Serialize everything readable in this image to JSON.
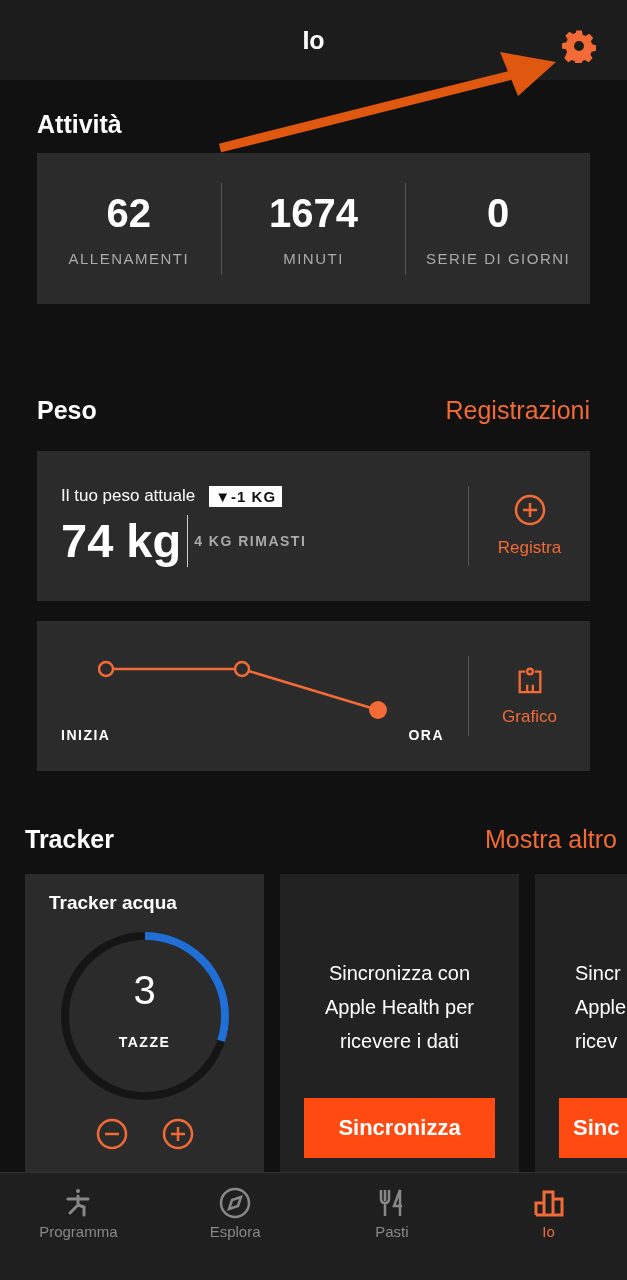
{
  "header": {
    "title": "Io"
  },
  "activity": {
    "title": "Attività",
    "stats": [
      {
        "value": "62",
        "label": "ALLENAMENTI"
      },
      {
        "value": "1674",
        "label": "MINUTI"
      },
      {
        "value": "0",
        "label": "SERIE DI GIORNI"
      }
    ]
  },
  "weight": {
    "title": "Peso",
    "link": "Registrazioni",
    "current_label": "Il tuo peso attuale",
    "change_badge": "▼-1 KG",
    "value": "74 kg",
    "remaining": "4 KG RIMASTI",
    "log_button": "Registra",
    "chart_start": "INIZIA",
    "chart_end": "ORA",
    "chart_button": "Grafico"
  },
  "tracker": {
    "title": "Tracker",
    "link": "Mostra altro",
    "water": {
      "title": "Tracker acqua",
      "count": "3",
      "unit": "TAZZE",
      "level": 0.3
    },
    "cards": [
      {
        "lines": [
          "Sincronizza con",
          "Apple Health per",
          "ricevere i dati"
        ],
        "button": "Sincronizza"
      },
      {
        "lines": [
          "Sincr",
          "Apple",
          "ricev"
        ],
        "button": "Sinc"
      }
    ]
  },
  "tabs": [
    {
      "label": "Programma",
      "kind": "program",
      "selected": false
    },
    {
      "label": "Esplora",
      "kind": "explore",
      "selected": false
    },
    {
      "label": "Pasti",
      "kind": "meals",
      "selected": false
    },
    {
      "label": "Io",
      "kind": "me",
      "selected": true
    }
  ]
}
